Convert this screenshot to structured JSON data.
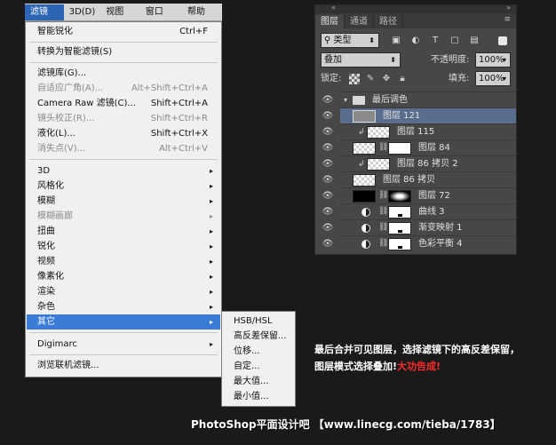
{
  "menubar": {
    "items": [
      {
        "label": "滤镜(T)",
        "active": true
      },
      {
        "label": "3D(D)",
        "active": false
      },
      {
        "label": "视图(V)",
        "active": false
      },
      {
        "label": "窗口(W)",
        "active": false
      },
      {
        "label": "帮助(H)",
        "active": false
      }
    ]
  },
  "filter_menu": {
    "items": [
      {
        "label": "智能锐化",
        "shortcut": "Ctrl+F"
      },
      {
        "label": "转换为智能滤镜(S)",
        "shortcut": ""
      },
      {
        "label": "滤镜库(G)...",
        "shortcut": ""
      },
      {
        "label": "自适应广角(A)...",
        "shortcut": "Alt+Shift+Ctrl+A"
      },
      {
        "label": "Camera Raw 滤镜(C)...",
        "shortcut": "Shift+Ctrl+A"
      },
      {
        "label": "镜头校正(R)...",
        "shortcut": "Shift+Ctrl+R"
      },
      {
        "label": "液化(L)...",
        "shortcut": "Shift+Ctrl+X"
      },
      {
        "label": "消失点(V)...",
        "shortcut": "Alt+Ctrl+V"
      },
      {
        "label": "3D"
      },
      {
        "label": "风格化"
      },
      {
        "label": "模糊"
      },
      {
        "label": "模糊画廊"
      },
      {
        "label": "扭曲"
      },
      {
        "label": "锐化"
      },
      {
        "label": "视频"
      },
      {
        "label": "像素化"
      },
      {
        "label": "渲染"
      },
      {
        "label": "杂色"
      },
      {
        "label": "其它"
      },
      {
        "label": "Digimarc"
      },
      {
        "label": "浏览联机滤镜..."
      }
    ],
    "submenu_arrow": "▸"
  },
  "other_submenu": {
    "items": [
      "HSB/HSL",
      "高反差保留...",
      "位移...",
      "自定...",
      "最大值...",
      "最小值..."
    ]
  },
  "layers_panel": {
    "tabs": [
      "图层",
      "通道",
      "路径"
    ],
    "filter_kind": "类型",
    "blend_mode": "叠加",
    "opacity_label": "不透明度:",
    "opacity_value": "100%",
    "lock_label": "锁定:",
    "fill_label": "填充:",
    "fill_value": "100%",
    "layers": [
      {
        "name": "最后调色",
        "type": "group"
      },
      {
        "name": "图层 121",
        "type": "pixel",
        "selected": true
      },
      {
        "name": "图层 115",
        "type": "pixel-clipped"
      },
      {
        "name": "图层 84",
        "type": "masked"
      },
      {
        "name": "图层 86 拷贝 2",
        "type": "pixel-clipped"
      },
      {
        "name": "图层 86 拷贝",
        "type": "pixel"
      },
      {
        "name": "图层 72",
        "type": "masked-black"
      },
      {
        "name": "曲线 3",
        "type": "adjustment"
      },
      {
        "name": "渐变映射 1",
        "type": "adjustment"
      },
      {
        "name": "色彩平衡 4",
        "type": "adjustment"
      }
    ]
  },
  "caption": {
    "line1": "最后合并可见图层，选择滤镜下的高反差保留，",
    "line2_prefix": "图层模式选择叠加!",
    "line2_red": "大功告成!"
  },
  "footer": "PhotoShop平面设计吧 【www.linecg.com/tieba/1783】",
  "colors": {
    "menu_highlight": "#3a7cd6",
    "panel_bg": "#474747",
    "selected_layer": "#5a6d8c",
    "caption_accent": "#ff2a2a"
  }
}
